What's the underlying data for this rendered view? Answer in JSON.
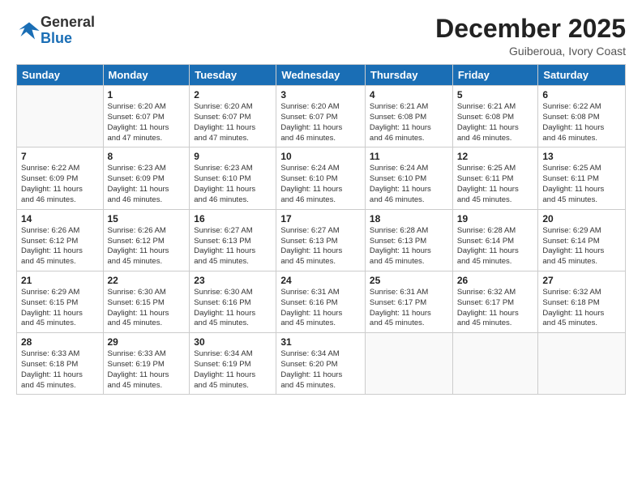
{
  "logo": {
    "general": "General",
    "blue": "Blue"
  },
  "title": "December 2025",
  "location": "Guiberoua, Ivory Coast",
  "days_header": [
    "Sunday",
    "Monday",
    "Tuesday",
    "Wednesday",
    "Thursday",
    "Friday",
    "Saturday"
  ],
  "weeks": [
    [
      {
        "day": "",
        "info": ""
      },
      {
        "day": "1",
        "info": "Sunrise: 6:20 AM\nSunset: 6:07 PM\nDaylight: 11 hours\nand 47 minutes."
      },
      {
        "day": "2",
        "info": "Sunrise: 6:20 AM\nSunset: 6:07 PM\nDaylight: 11 hours\nand 47 minutes."
      },
      {
        "day": "3",
        "info": "Sunrise: 6:20 AM\nSunset: 6:07 PM\nDaylight: 11 hours\nand 46 minutes."
      },
      {
        "day": "4",
        "info": "Sunrise: 6:21 AM\nSunset: 6:08 PM\nDaylight: 11 hours\nand 46 minutes."
      },
      {
        "day": "5",
        "info": "Sunrise: 6:21 AM\nSunset: 6:08 PM\nDaylight: 11 hours\nand 46 minutes."
      },
      {
        "day": "6",
        "info": "Sunrise: 6:22 AM\nSunset: 6:08 PM\nDaylight: 11 hours\nand 46 minutes."
      }
    ],
    [
      {
        "day": "7",
        "info": "Sunrise: 6:22 AM\nSunset: 6:09 PM\nDaylight: 11 hours\nand 46 minutes."
      },
      {
        "day": "8",
        "info": "Sunrise: 6:23 AM\nSunset: 6:09 PM\nDaylight: 11 hours\nand 46 minutes."
      },
      {
        "day": "9",
        "info": "Sunrise: 6:23 AM\nSunset: 6:10 PM\nDaylight: 11 hours\nand 46 minutes."
      },
      {
        "day": "10",
        "info": "Sunrise: 6:24 AM\nSunset: 6:10 PM\nDaylight: 11 hours\nand 46 minutes."
      },
      {
        "day": "11",
        "info": "Sunrise: 6:24 AM\nSunset: 6:10 PM\nDaylight: 11 hours\nand 46 minutes."
      },
      {
        "day": "12",
        "info": "Sunrise: 6:25 AM\nSunset: 6:11 PM\nDaylight: 11 hours\nand 45 minutes."
      },
      {
        "day": "13",
        "info": "Sunrise: 6:25 AM\nSunset: 6:11 PM\nDaylight: 11 hours\nand 45 minutes."
      }
    ],
    [
      {
        "day": "14",
        "info": "Sunrise: 6:26 AM\nSunset: 6:12 PM\nDaylight: 11 hours\nand 45 minutes."
      },
      {
        "day": "15",
        "info": "Sunrise: 6:26 AM\nSunset: 6:12 PM\nDaylight: 11 hours\nand 45 minutes."
      },
      {
        "day": "16",
        "info": "Sunrise: 6:27 AM\nSunset: 6:13 PM\nDaylight: 11 hours\nand 45 minutes."
      },
      {
        "day": "17",
        "info": "Sunrise: 6:27 AM\nSunset: 6:13 PM\nDaylight: 11 hours\nand 45 minutes."
      },
      {
        "day": "18",
        "info": "Sunrise: 6:28 AM\nSunset: 6:13 PM\nDaylight: 11 hours\nand 45 minutes."
      },
      {
        "day": "19",
        "info": "Sunrise: 6:28 AM\nSunset: 6:14 PM\nDaylight: 11 hours\nand 45 minutes."
      },
      {
        "day": "20",
        "info": "Sunrise: 6:29 AM\nSunset: 6:14 PM\nDaylight: 11 hours\nand 45 minutes."
      }
    ],
    [
      {
        "day": "21",
        "info": "Sunrise: 6:29 AM\nSunset: 6:15 PM\nDaylight: 11 hours\nand 45 minutes."
      },
      {
        "day": "22",
        "info": "Sunrise: 6:30 AM\nSunset: 6:15 PM\nDaylight: 11 hours\nand 45 minutes."
      },
      {
        "day": "23",
        "info": "Sunrise: 6:30 AM\nSunset: 6:16 PM\nDaylight: 11 hours\nand 45 minutes."
      },
      {
        "day": "24",
        "info": "Sunrise: 6:31 AM\nSunset: 6:16 PM\nDaylight: 11 hours\nand 45 minutes."
      },
      {
        "day": "25",
        "info": "Sunrise: 6:31 AM\nSunset: 6:17 PM\nDaylight: 11 hours\nand 45 minutes."
      },
      {
        "day": "26",
        "info": "Sunrise: 6:32 AM\nSunset: 6:17 PM\nDaylight: 11 hours\nand 45 minutes."
      },
      {
        "day": "27",
        "info": "Sunrise: 6:32 AM\nSunset: 6:18 PM\nDaylight: 11 hours\nand 45 minutes."
      }
    ],
    [
      {
        "day": "28",
        "info": "Sunrise: 6:33 AM\nSunset: 6:18 PM\nDaylight: 11 hours\nand 45 minutes."
      },
      {
        "day": "29",
        "info": "Sunrise: 6:33 AM\nSunset: 6:19 PM\nDaylight: 11 hours\nand 45 minutes."
      },
      {
        "day": "30",
        "info": "Sunrise: 6:34 AM\nSunset: 6:19 PM\nDaylight: 11 hours\nand 45 minutes."
      },
      {
        "day": "31",
        "info": "Sunrise: 6:34 AM\nSunset: 6:20 PM\nDaylight: 11 hours\nand 45 minutes."
      },
      {
        "day": "",
        "info": ""
      },
      {
        "day": "",
        "info": ""
      },
      {
        "day": "",
        "info": ""
      }
    ]
  ]
}
